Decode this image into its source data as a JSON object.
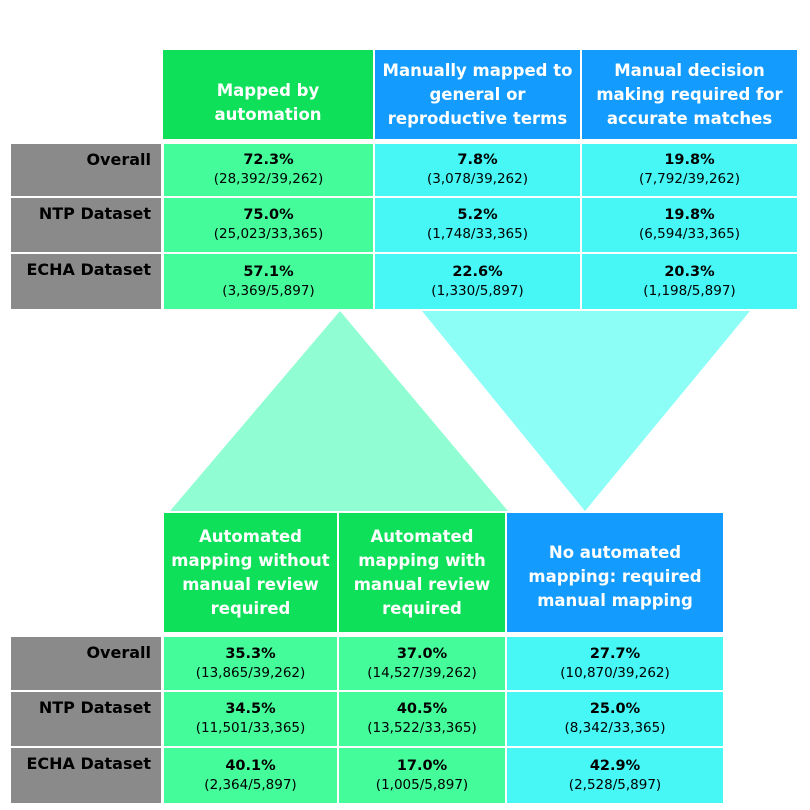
{
  "colors": {
    "header_green": "#0fe05a",
    "header_blue": "#139bfd",
    "data_green": "#45fc9a",
    "data_cyan": "#46f7f5",
    "label_gray": "#8a8a8a",
    "triangle_up": "#90fed2",
    "triangle_down": "#8cfef6"
  },
  "top_table": {
    "headers": [
      "Mapped by automation",
      "Manually mapped to general or reproductive terms",
      "Manual decision making required for accurate matches"
    ],
    "rows": [
      {
        "label": "Overall",
        "cells": [
          {
            "pct": "72.3%",
            "frac": "(28,392/39,262)"
          },
          {
            "pct": "7.8%",
            "frac": "(3,078/39,262)"
          },
          {
            "pct": "19.8%",
            "frac": "(7,792/39,262)"
          }
        ]
      },
      {
        "label": "NTP Dataset",
        "cells": [
          {
            "pct": "75.0%",
            "frac": "(25,023/33,365)"
          },
          {
            "pct": "5.2%",
            "frac": "(1,748/33,365)"
          },
          {
            "pct": "19.8%",
            "frac": "(6,594/33,365)"
          }
        ]
      },
      {
        "label": "ECHA Dataset",
        "cells": [
          {
            "pct": "57.1%",
            "frac": "(3,369/5,897)"
          },
          {
            "pct": "22.6%",
            "frac": "(1,330/5,897)"
          },
          {
            "pct": "20.3%",
            "frac": "(1,198/5,897)"
          }
        ]
      }
    ]
  },
  "bottom_table": {
    "headers": [
      "Automated mapping without manual review required",
      "Automated mapping with manual review required",
      "No automated mapping: required manual mapping"
    ],
    "rows": [
      {
        "label": "Overall",
        "cells": [
          {
            "pct": "35.3%",
            "frac": "(13,865/39,262)"
          },
          {
            "pct": "37.0%",
            "frac": "(14,527/39,262)"
          },
          {
            "pct": "27.7%",
            "frac": "(10,870/39,262)"
          }
        ]
      },
      {
        "label": "NTP Dataset",
        "cells": [
          {
            "pct": "34.5%",
            "frac": "(11,501/33,365)"
          },
          {
            "pct": "40.5%",
            "frac": "(13,522/33,365)"
          },
          {
            "pct": "25.0%",
            "frac": "(8,342/33,365)"
          }
        ]
      },
      {
        "label": "ECHA Dataset",
        "cells": [
          {
            "pct": "40.1%",
            "frac": "(2,364/5,897)"
          },
          {
            "pct": "17.0%",
            "frac": "(1,005/5,897)"
          },
          {
            "pct": "42.9%",
            "frac": "(2,528/5,897)"
          }
        ]
      }
    ]
  }
}
